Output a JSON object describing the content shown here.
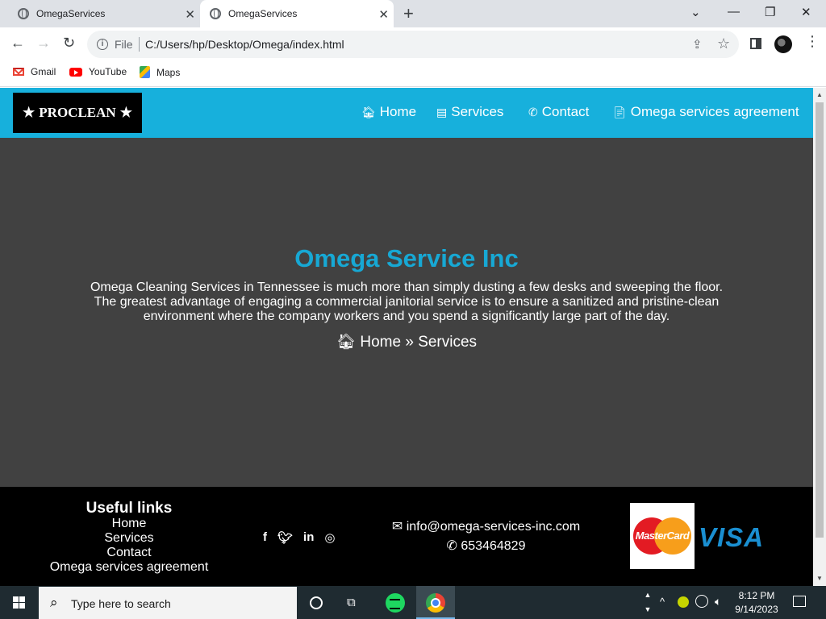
{
  "browser": {
    "tabs": [
      {
        "title": "OmegaServices",
        "close": "✕"
      },
      {
        "title": "OmegaServices",
        "close": "✕"
      }
    ],
    "new_tab": "+",
    "window_controls": {
      "tab_search": "⌄",
      "minimize": "—",
      "restore": "❐",
      "close": "✕"
    },
    "nav": {
      "back": "←",
      "forward": "→",
      "reload": "↻"
    },
    "address": {
      "scheme_label": "File",
      "url": "C:/Users/hp/Desktop/Omega/index.html"
    },
    "bookmarks": [
      {
        "label": "Gmail",
        "icon": "gmail-icon"
      },
      {
        "label": "YouTube",
        "icon": "youtube-icon"
      },
      {
        "label": "Maps",
        "icon": "maps-icon"
      }
    ]
  },
  "site": {
    "logo": {
      "star": "★",
      "text": "PROCLEAN"
    },
    "nav": [
      {
        "icon": "🏠︎",
        "label": "Home"
      },
      {
        "icon": "▤",
        "label": "Services"
      },
      {
        "icon": "✆",
        "label": "Contact"
      },
      {
        "icon": "📄︎",
        "label": "Omega services agreement"
      }
    ],
    "hero": {
      "title": "Omega Service Inc",
      "text": "Omega Cleaning Services in Tennessee is much more than simply dusting a few desks and sweeping the floor. The greatest advantage of engaging a commercial janitorial service is to ensure a sanitized and pristine-clean environment where the company workers and you spend a significantly large part of the day.",
      "breadcrumb": {
        "home_icon": "🏠︎",
        "home": "Home",
        "separator": "»",
        "current": "Services"
      }
    },
    "footer": {
      "useful_title": "Useful links",
      "useful_links": [
        "Home",
        "Services",
        "Contact",
        "Omega services agreement"
      ],
      "social": [
        {
          "icon": "facebook-icon",
          "glyph": "f"
        },
        {
          "icon": "twitter-icon",
          "glyph": "🐦︎"
        },
        {
          "icon": "linkedin-icon",
          "glyph": "in"
        },
        {
          "icon": "instagram-icon",
          "glyph": "◎"
        }
      ],
      "email_icon": "✉",
      "email": "info@omega-services-inc.com",
      "phone_icon": "✆",
      "phone": "653464829",
      "payment": {
        "mastercard": "MasterCard",
        "visa": "VISA"
      }
    }
  },
  "taskbar": {
    "search_placeholder": "Type here to search",
    "time": "8:12 PM",
    "date": "9/14/2023"
  },
  "colors": {
    "header": "#17b0dc",
    "hero_bg": "#414141",
    "title": "#17a8d4",
    "footer_bg": "#000000"
  }
}
